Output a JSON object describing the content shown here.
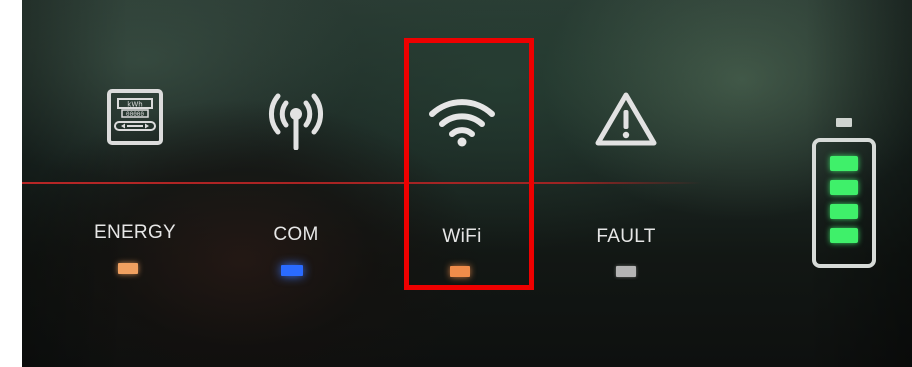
{
  "indicators": {
    "energy": {
      "label": "ENERGY",
      "icon": "energy-meter-icon",
      "led_color": "#f0a060"
    },
    "com": {
      "label": "COM",
      "icon": "antenna-signal-icon",
      "led_color": "#2a6bff"
    },
    "wifi": {
      "label": "WiFi",
      "icon": "wifi-icon",
      "led_color": "#f08c4a"
    },
    "fault": {
      "label": "FAULT",
      "icon": "warning-triangle-icon",
      "led_color": "#b4b4b4"
    }
  },
  "meter_icon_text": {
    "top": "kWh",
    "mid": "00000"
  },
  "battery": {
    "icon": "battery-icon",
    "level_segments": 4,
    "segment_color": "#3ff06a"
  },
  "highlight": {
    "target": "wifi",
    "color": "#ee0000"
  }
}
